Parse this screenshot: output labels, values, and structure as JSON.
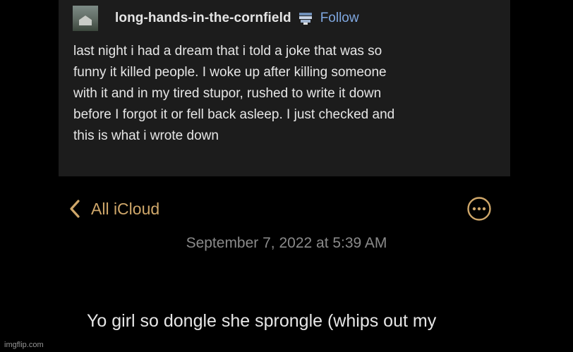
{
  "post": {
    "username": "long-hands-in-the-cornfield",
    "follow_label": "Follow",
    "body": "last night i had a dream that i told a joke that was so\nfunny it killed people. I woke up after killing someone\nwith it and in my tired stupor, rushed to write it down\nbefore I forgot it or fell back asleep. I just checked and\nthis is what i wrote down"
  },
  "notes": {
    "back_label": "All iCloud",
    "date": "September 7, 2022 at 5:39 AM",
    "content": "Yo girl so dongle she sprongle (whips out my"
  },
  "icons": {
    "avatar": "avatar-image",
    "badge": "badge-icon",
    "back": "chevron-left-icon",
    "more": "more-ellipsis-circle-icon"
  },
  "colors": {
    "background": "#000000",
    "card": "#1c1c1c",
    "follow": "#7fa7e0",
    "accent": "#cfa76a",
    "date": "#8a8a8a"
  },
  "watermark": "imgflip.com"
}
